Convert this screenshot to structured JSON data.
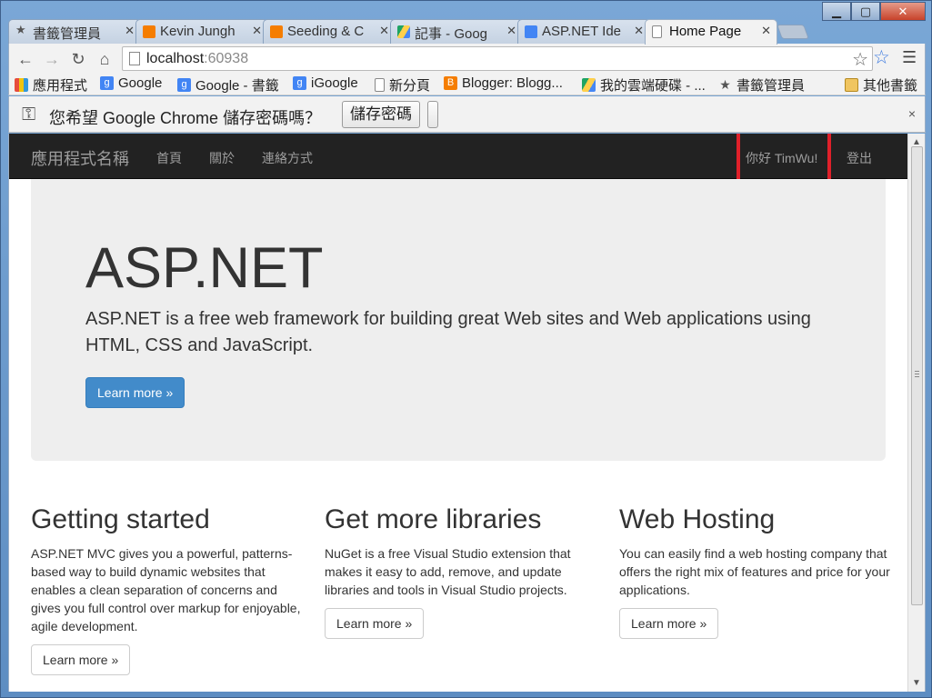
{
  "chrome": {
    "tabs": [
      {
        "label": "書籤管理員",
        "icon": "star-icon",
        "color": "#555555"
      },
      {
        "label": "Kevin Jungh",
        "icon": "blogger-icon",
        "color": "#f57d00"
      },
      {
        "label": "Seeding & C",
        "icon": "blogger-icon",
        "color": "#f57d00"
      },
      {
        "label": "記事 - Goog",
        "icon": "google-drive-icon",
        "color": "#1fa463"
      },
      {
        "label": "ASP.NET Ide",
        "icon": "docs-icon",
        "color": "#4285f4"
      },
      {
        "label": "Home Page",
        "icon": "page-icon",
        "color": "#888888",
        "active": true
      }
    ],
    "address": {
      "host": "localhost",
      "port": ":60938"
    },
    "bookmarks": [
      {
        "label": "應用程式",
        "icon": "apps-grid-icon"
      },
      {
        "label": "Google",
        "icon": "google-icon"
      },
      {
        "label": "Google - 書籤",
        "icon": "google-icon"
      },
      {
        "label": "iGoogle",
        "icon": "google-icon"
      },
      {
        "label": "新分頁",
        "icon": "page-icon"
      },
      {
        "label": "Blogger: Blogg...",
        "icon": "blogger-icon"
      },
      {
        "label": "我的雲端硬碟 - ...",
        "icon": "google-drive-icon"
      },
      {
        "label": "書籤管理員",
        "icon": "star-icon"
      },
      {
        "label": "其他書籤",
        "icon": "folder-icon"
      }
    ]
  },
  "infobar": {
    "message": "您希望 Google Chrome 儲存密碼嗎？",
    "save_label": "儲存密碼",
    "dismiss": "×"
  },
  "navbar": {
    "brand": "應用程式名稱",
    "links": [
      "首頁",
      "關於",
      "連絡方式"
    ],
    "greeting": "你好 TimWu!",
    "logout": "登出"
  },
  "jumbotron": {
    "title": "ASP.NET",
    "lead": "ASP.NET is a free web framework for building great Web sites and Web applications using HTML, CSS and JavaScript.",
    "button": "Learn more »"
  },
  "columns": [
    {
      "title": "Getting started",
      "text": "ASP.NET MVC gives you a powerful, patterns-based way to build dynamic websites that enables a clean separation of concerns and gives you full control over markup for enjoyable, agile development.",
      "button": "Learn more »"
    },
    {
      "title": "Get more libraries",
      "text": "NuGet is a free Visual Studio extension that makes it easy to add, remove, and update libraries and tools in Visual Studio projects.",
      "button": "Learn more »"
    },
    {
      "title": "Web Hosting",
      "text": "You can easily find a web hosting company that offers the right mix of features and price for your applications.",
      "button": "Learn more »"
    }
  ]
}
